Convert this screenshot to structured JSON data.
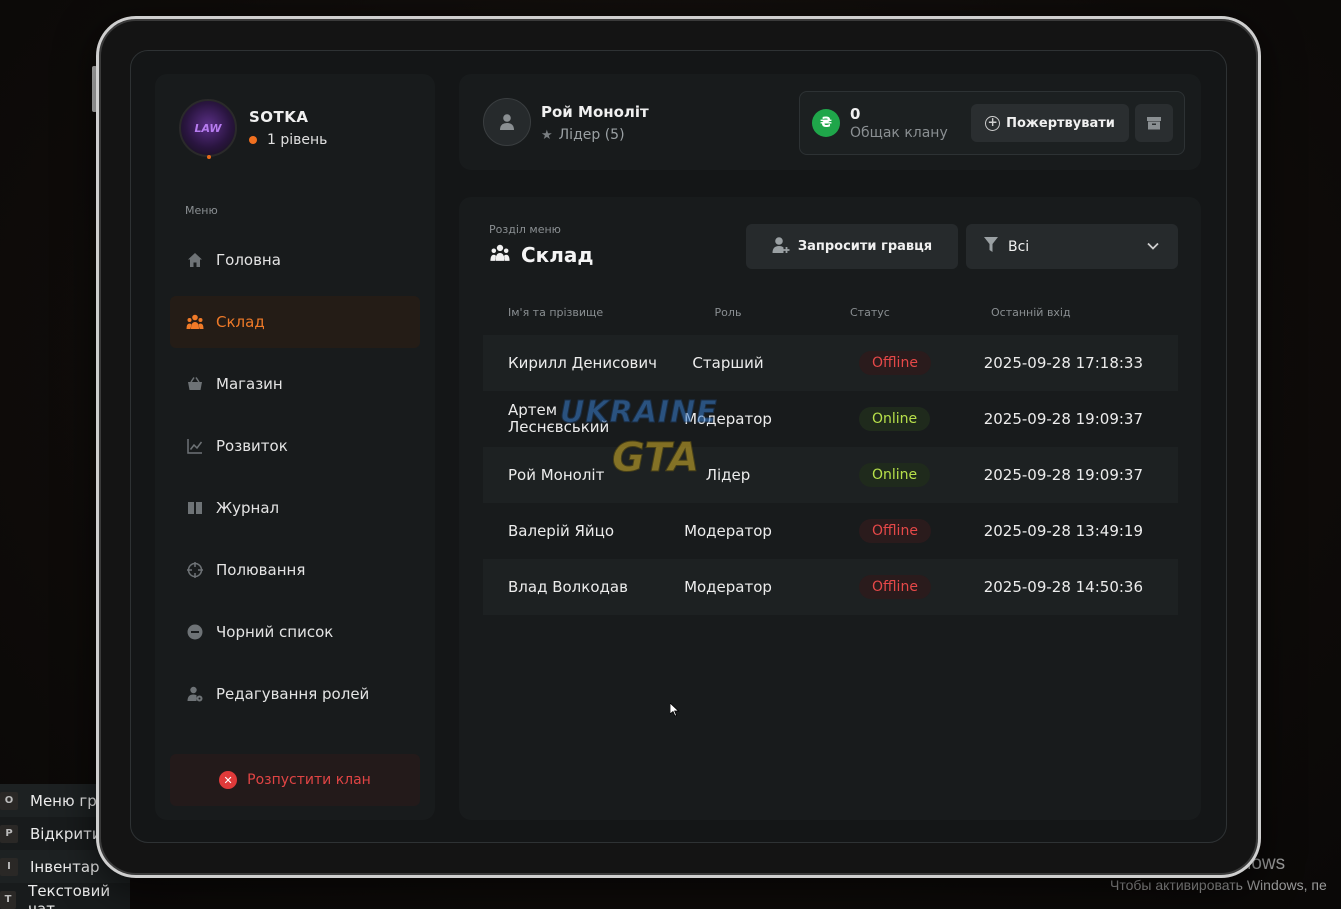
{
  "background": {
    "hud": [
      {
        "key": "O",
        "label": "Меню гра"
      },
      {
        "key": "P",
        "label": "Відкрити"
      },
      {
        "key": "I",
        "label": "Інвентар"
      },
      {
        "key": "T",
        "label": "Текстовий чат"
      }
    ],
    "windows_activation": {
      "title": "Активация Windows",
      "subtitle": "Чтобы активировать Windows, пе"
    }
  },
  "profile": {
    "clan_name": "SOTKA",
    "level": "1 рівень",
    "avatar_text": "LAW"
  },
  "menu": {
    "label": "Меню",
    "items": [
      {
        "label": "Головна",
        "icon": "home-icon"
      },
      {
        "label": "Склад",
        "icon": "users-icon",
        "active": true
      },
      {
        "label": "Магазин",
        "icon": "basket-icon"
      },
      {
        "label": "Розвиток",
        "icon": "chart-icon"
      },
      {
        "label": "Журнал",
        "icon": "book-icon"
      },
      {
        "label": "Полювання",
        "icon": "crosshair-icon"
      },
      {
        "label": "Чорний список",
        "icon": "minus-circle-icon"
      },
      {
        "label": "Редагування ролей",
        "icon": "user-gear-icon"
      }
    ],
    "disband_label": "Розпустити клан"
  },
  "header": {
    "leader_name": "Рой Моноліт",
    "leader_role": "Лідер (5)",
    "bank_amount": "0",
    "bank_label": "Общак клану",
    "donate_label": "Пожертвувати"
  },
  "main": {
    "section_label": "Розділ меню",
    "section_title": "Склад",
    "invite_label": "Запросити гравця",
    "filter_value": "Всі",
    "columns": [
      "Ім'я та прізвище",
      "Роль",
      "Статус",
      "Останній вхід"
    ],
    "rows": [
      {
        "name": "Кирилл Денисович",
        "role": "Старший",
        "status": "Offline",
        "last": "2025-09-28 17:18:33"
      },
      {
        "name": "Артем Леснєвський",
        "role": "Модератор",
        "status": "Online",
        "last": "2025-09-28 19:09:37"
      },
      {
        "name": "Рой Моноліт",
        "role": "Лідер",
        "status": "Online",
        "last": "2025-09-28 19:09:37"
      },
      {
        "name": "Валерій Яйцо",
        "role": "Модератор",
        "status": "Offline",
        "last": "2025-09-28 13:49:19"
      },
      {
        "name": "Влад Волкодав",
        "role": "Модератор",
        "status": "Offline",
        "last": "2025-09-28 14:50:36"
      }
    ]
  },
  "watermark": {
    "line1": "UKRAINE",
    "line2": "GTA"
  },
  "colors": {
    "accent": "#f07a28",
    "online": "#b7e04a",
    "offline": "#e54848",
    "coin": "#1fa64a"
  }
}
